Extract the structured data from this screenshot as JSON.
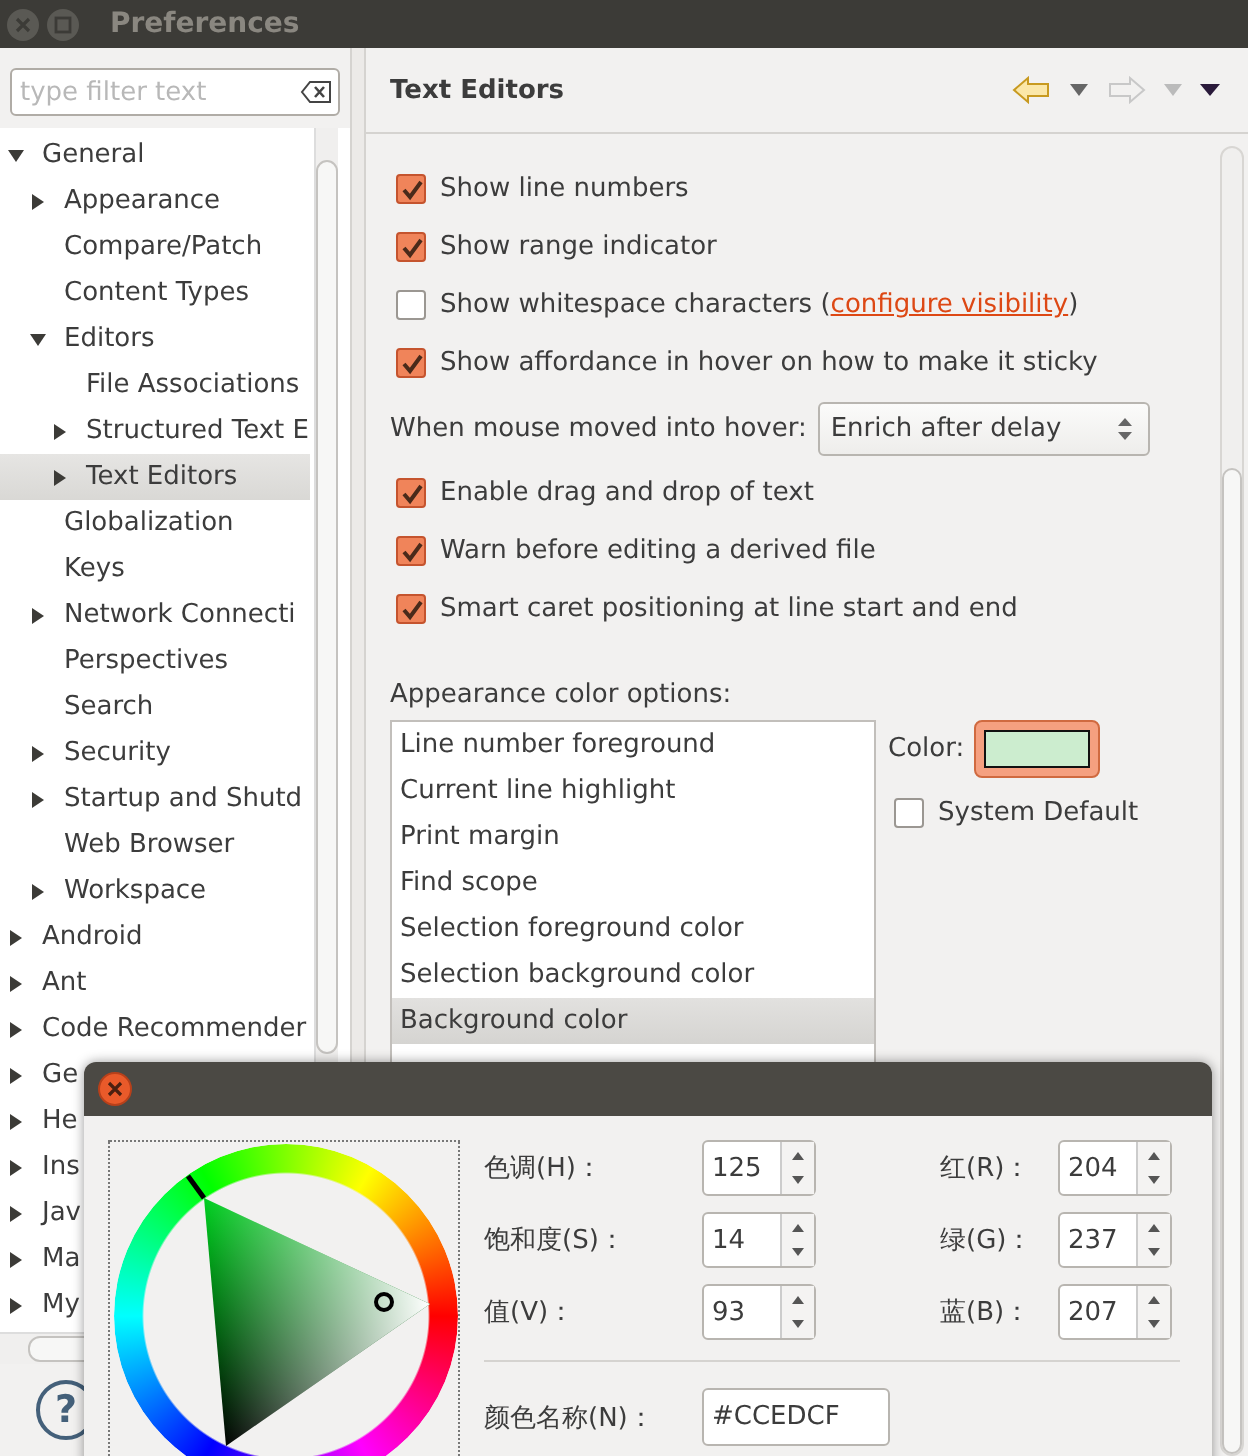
{
  "window": {
    "title": "Preferences"
  },
  "filter": {
    "placeholder": "type filter text"
  },
  "tree": [
    {
      "label": "General",
      "expanded": true,
      "selected": false,
      "children": [
        {
          "label": "Appearance",
          "expanded": false,
          "selected": false
        },
        {
          "label": "Compare/Patch",
          "selected": false
        },
        {
          "label": "Content Types",
          "selected": false
        },
        {
          "label": "Editors",
          "expanded": true,
          "selected": false,
          "children": [
            {
              "label": "File Associations",
              "selected": false
            },
            {
              "label": "Structured Text E",
              "expanded": false,
              "selected": false
            },
            {
              "label": "Text Editors",
              "expanded": false,
              "selected": true
            }
          ]
        },
        {
          "label": "Globalization",
          "selected": false
        },
        {
          "label": "Keys",
          "selected": false
        },
        {
          "label": "Network Connecti",
          "expanded": false,
          "selected": false
        },
        {
          "label": "Perspectives",
          "selected": false
        },
        {
          "label": "Search",
          "selected": false
        },
        {
          "label": "Security",
          "expanded": false,
          "selected": false
        },
        {
          "label": "Startup and Shutd",
          "expanded": false,
          "selected": false
        },
        {
          "label": "Web Browser",
          "selected": false
        },
        {
          "label": "Workspace",
          "expanded": false,
          "selected": false
        }
      ]
    },
    {
      "label": "Android",
      "expanded": false,
      "selected": false
    },
    {
      "label": "Ant",
      "expanded": false,
      "selected": false
    },
    {
      "label": "Code Recommender",
      "expanded": false,
      "selected": false
    },
    {
      "label": "Ge",
      "expanded": false,
      "selected": false
    },
    {
      "label": "He",
      "expanded": false,
      "selected": false
    },
    {
      "label": "Ins",
      "expanded": false,
      "selected": false
    },
    {
      "label": "Jav",
      "expanded": false,
      "selected": false
    },
    {
      "label": "Ma",
      "expanded": false,
      "selected": false
    },
    {
      "label": "My",
      "expanded": false,
      "selected": false
    }
  ],
  "help": {
    "glyph": "?"
  },
  "page": {
    "title": "Text Editors",
    "back": {
      "disabled": false
    },
    "forward": {
      "disabled": true
    }
  },
  "options": [
    {
      "kind": "checkbox",
      "label": "Show line numbers",
      "checked": true
    },
    {
      "kind": "checkbox",
      "label": "Show range indicator",
      "checked": true
    },
    {
      "kind": "checkbox",
      "label": "Show whitespace characters (",
      "link": "configure visibility",
      "suffix": ")",
      "checked": false
    },
    {
      "kind": "checkbox",
      "label": "Show affordance in hover on how to make it sticky",
      "checked": true
    },
    {
      "kind": "combo",
      "label": "When mouse moved into hover:",
      "value": "Enrich after delay"
    },
    {
      "kind": "checkbox",
      "label": "Enable drag and drop of text",
      "checked": true
    },
    {
      "kind": "checkbox",
      "label": "Warn before editing a derived file",
      "checked": true
    },
    {
      "kind": "checkbox",
      "label": "Smart caret positioning at line start and end",
      "checked": true
    }
  ],
  "appearance": {
    "label": "Appearance color options:",
    "items": [
      {
        "label": "Line number foreground",
        "selected": false
      },
      {
        "label": "Current line highlight",
        "selected": false
      },
      {
        "label": "Print margin",
        "selected": false
      },
      {
        "label": "Find scope",
        "selected": false
      },
      {
        "label": "Selection foreground color",
        "selected": false
      },
      {
        "label": "Selection background color",
        "selected": false
      },
      {
        "label": "Background color",
        "selected": true
      }
    ],
    "color_label": "Color:",
    "color": "#ccedcf",
    "system_default": {
      "label": "System Default",
      "checked": false
    }
  },
  "color_dialog": {
    "hsv": [
      {
        "label": "色调(H)：",
        "value": "125"
      },
      {
        "label": "饱和度(S)：",
        "value": "14"
      },
      {
        "label": "值(V)：",
        "value": "93"
      }
    ],
    "rgb": [
      {
        "label": "红(R)：",
        "value": "204"
      },
      {
        "label": "绿(G)：",
        "value": "237"
      },
      {
        "label": "蓝(B)：",
        "value": "207"
      }
    ],
    "name": {
      "label": "颜色名称(N)：",
      "value": "#CCEDCF"
    }
  }
}
